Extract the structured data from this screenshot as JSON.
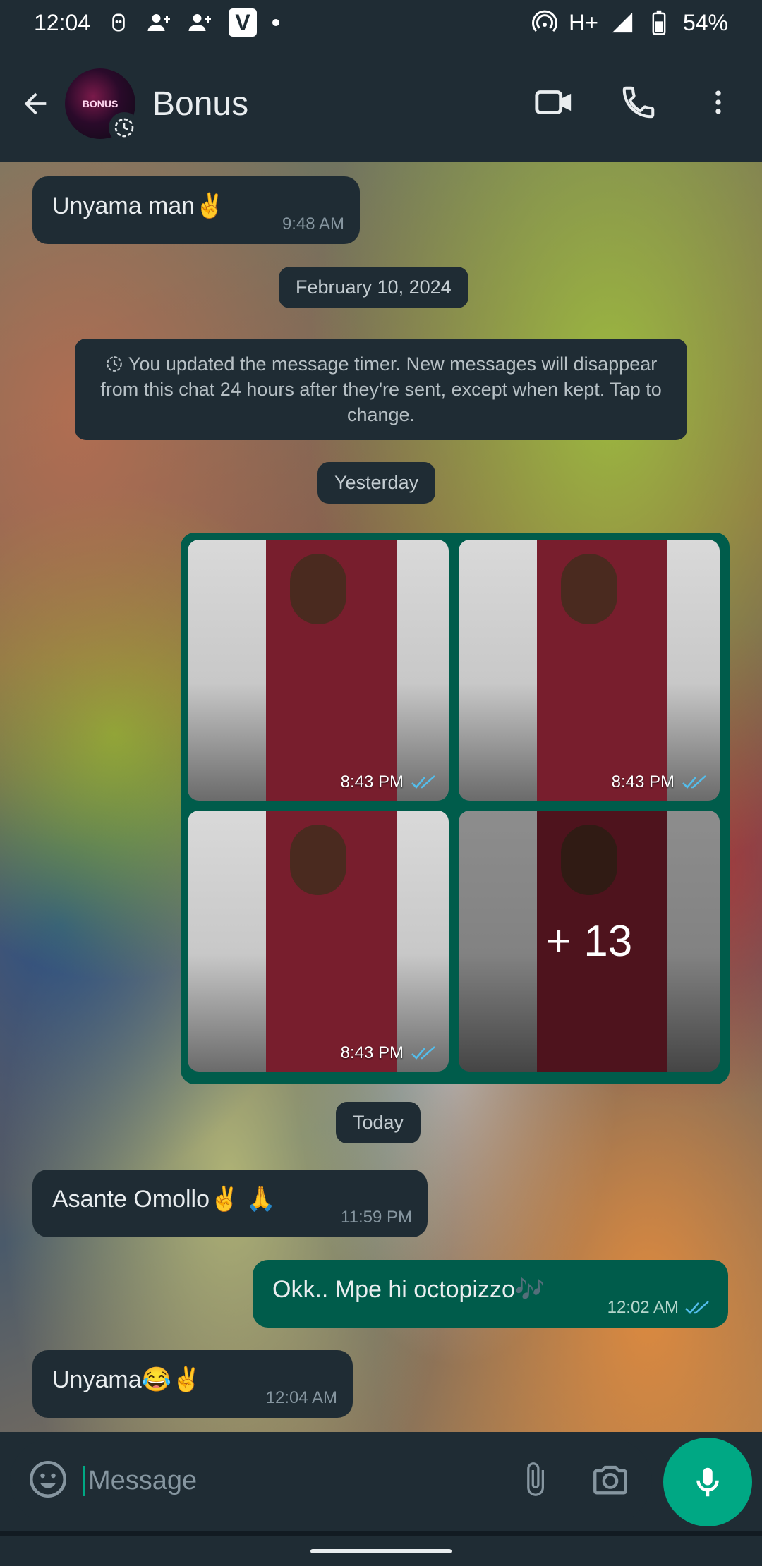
{
  "status_bar": {
    "time": "12:04",
    "network": "H+",
    "battery": "54%"
  },
  "header": {
    "title": "Bonus",
    "avatar_text": "BONUS"
  },
  "messages": [
    {
      "id": "m1",
      "direction": "in",
      "text": "Unyama man✌️",
      "time": "9:48 AM"
    },
    {
      "id": "m2",
      "direction": "in",
      "text": "Asante Omollo✌️ 🙏",
      "time": "11:59 PM"
    },
    {
      "id": "m3",
      "direction": "out",
      "text": "Okk.. Mpe hi octopizzo🎶",
      "time": "12:02 AM"
    },
    {
      "id": "m4",
      "direction": "in",
      "text": "Unyama😂✌️",
      "time": "12:04 AM"
    }
  ],
  "date_pills": {
    "feb": "February 10, 2024",
    "yesterday": "Yesterday",
    "today": "Today"
  },
  "system_message": "You updated the message timer. New messages will disappear from this chat 24 hours after they're sent, except when kept. Tap to change.",
  "album": {
    "photo_times": [
      "8:43 PM",
      "8:43 PM",
      "8:43 PM"
    ],
    "more_count": "+ 13"
  },
  "composer": {
    "placeholder": "Message"
  },
  "colors": {
    "bg": "#1f2c34",
    "outgoing": "#005c4b",
    "accent": "#00a884",
    "read_tick": "#53bdeb"
  },
  "icons": {
    "back": "arrow-left-icon",
    "video": "video-camera-icon",
    "call": "phone-icon",
    "menu": "more-vertical-icon",
    "emoji": "emoji-icon",
    "attach": "paperclip-icon",
    "camera": "camera-icon",
    "mic": "microphone-icon",
    "timer": "disappearing-timer-icon"
  }
}
